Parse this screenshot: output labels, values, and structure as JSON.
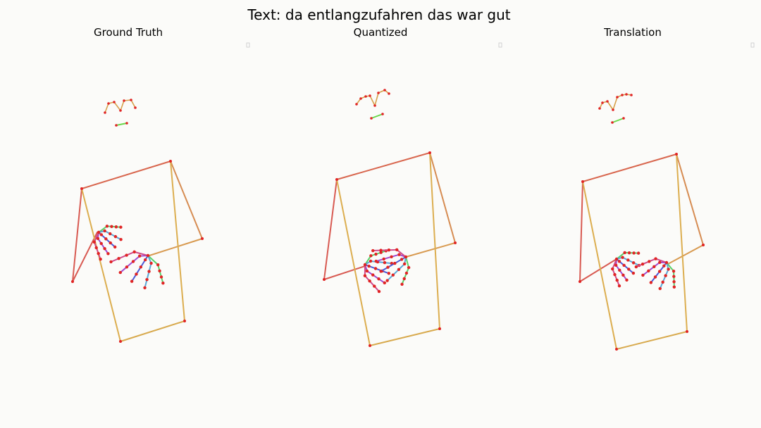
{
  "figure": {
    "title": "Text: da entlangzufahren das war gut",
    "background": "#fbfbf9"
  },
  "colors": {
    "joint": "#e02424",
    "torso_top": "#d8664e",
    "torso_right": "#d68c52",
    "torso_left_arm": "#d85a52",
    "torso_side": "#dcae50",
    "torso_bottom": "#d8aa4e",
    "arm_to_hand": "#d89a50",
    "face_curve": "#d6a04a",
    "face_line": "#6bd84c",
    "hand_thumb": "#58d26a",
    "hand_finger_a": "#5aa8d8",
    "hand_finger_b": "#4a5ad8",
    "hand_finger_c": "#a04ad0",
    "hand_finger_d": "#d04a8a"
  },
  "panels": [
    {
      "id": "ground-truth",
      "title": "Ground Truth",
      "face_points": [
        [
          149,
          160
        ],
        [
          154,
          147
        ],
        [
          162,
          145
        ],
        [
          171,
          157
        ],
        [
          176,
          143
        ],
        [
          186,
          142
        ],
        [
          192,
          153
        ]
      ],
      "face_line": [
        [
          165,
          178
        ],
        [
          180,
          175
        ]
      ],
      "body": {
        "shoulder_l": [
          116,
          268
        ],
        "shoulder_r": [
          242,
          229
        ],
        "hip_l": [
          171,
          485
        ],
        "hip_r": [
          262,
          456
        ],
        "elbow_l": [
          103,
          400
        ],
        "elbow_r": [
          287,
          339
        ],
        "wrist_l": [
          138,
          330
        ],
        "wrist_r": [
          212,
          363
        ]
      },
      "hand_a": {
        "root": [
          140,
          330
        ],
        "spread": 1.0,
        "angle": 42,
        "len": 26
      },
      "hand_b": {
        "root": [
          210,
          363
        ],
        "spread": 1.25,
        "angle": 122,
        "len": 36
      }
    },
    {
      "id": "quantized",
      "title": "Quantized",
      "face_points": [
        [
          506,
          148
        ],
        [
          512,
          140
        ],
        [
          519,
          137
        ],
        [
          525,
          136
        ],
        [
          532,
          150
        ],
        [
          537,
          132
        ],
        [
          546,
          128
        ],
        [
          552,
          133
        ]
      ],
      "face_line": [
        [
          527,
          168
        ],
        [
          543,
          162
        ]
      ],
      "body": {
        "shoulder_l": [
          478,
          255
        ],
        "shoulder_r": [
          610,
          217
        ],
        "hip_l": [
          525,
          491
        ],
        "hip_r": [
          624,
          467
        ],
        "elbow_l": [
          460,
          397
        ],
        "elbow_r": [
          646,
          345
        ],
        "wrist_l": [
          518,
          378
        ],
        "wrist_r": [
          576,
          365
        ]
      },
      "hand_a": {
        "root": [
          518,
          376
        ],
        "spread": 1.0,
        "angle": 20,
        "len": 30
      },
      "hand_b": {
        "root": [
          576,
          365
        ],
        "spread": 1.0,
        "angle": 150,
        "len": 34
      }
    },
    {
      "id": "translation",
      "title": "Translation",
      "face_points": [
        [
          851,
          154
        ],
        [
          855,
          146
        ],
        [
          862,
          144
        ],
        [
          870,
          156
        ],
        [
          876,
          138
        ],
        [
          883,
          135
        ],
        [
          889,
          134
        ],
        [
          896,
          135
        ]
      ],
      "face_line": [
        [
          869,
          174
        ],
        [
          885,
          168
        ]
      ],
      "body": {
        "shoulder_l": [
          827,
          258
        ],
        "shoulder_r": [
          960,
          219
        ],
        "hip_l": [
          875,
          496
        ],
        "hip_r": [
          975,
          471
        ],
        "elbow_l": [
          823,
          400
        ],
        "elbow_r": [
          998,
          348
        ],
        "wrist_l": [
          875,
          368
        ],
        "wrist_r": [
          948,
          375
        ]
      },
      "hand_a": {
        "root": [
          875,
          368
        ],
        "spread": 1.0,
        "angle": 40,
        "len": 26
      },
      "hand_b": {
        "root": [
          946,
          373
        ],
        "spread": 1.05,
        "angle": 128,
        "len": 30
      }
    }
  ]
}
